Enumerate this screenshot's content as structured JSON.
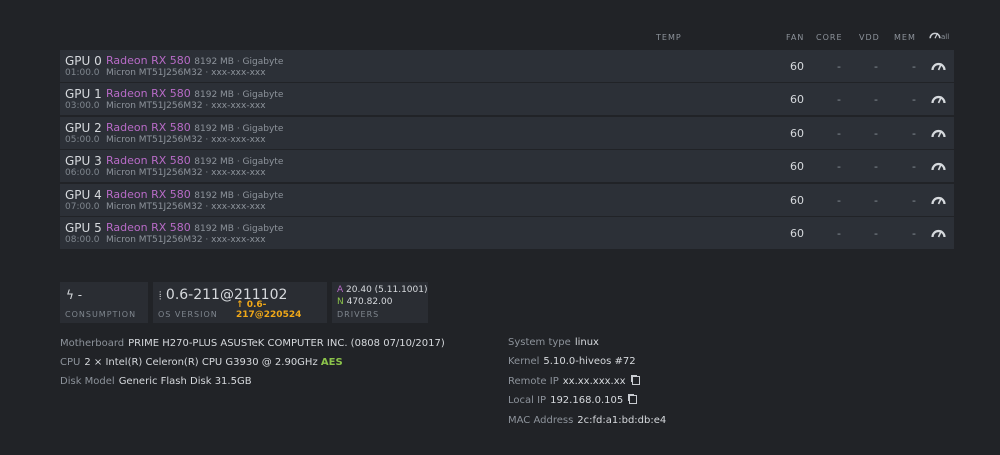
{
  "columns": {
    "temp": "TEMP",
    "fan": "FAN",
    "core": "CORE",
    "vdd": "VDD",
    "mem": "MEM",
    "all": "all"
  },
  "gpus": [
    {
      "name": "GPU 0",
      "bus": "01:00.0",
      "model": "Radeon RX 580",
      "memory": "8192 MB · Gigabyte",
      "sub": "Micron MT51J256M32 · xxx-xxx-xxx",
      "fan": "60",
      "core": "-",
      "vdd": "-",
      "mem": "-"
    },
    {
      "name": "GPU 1",
      "bus": "03:00.0",
      "model": "Radeon RX 580",
      "memory": "8192 MB · Gigabyte",
      "sub": "Micron MT51J256M32 · xxx-xxx-xxx",
      "fan": "60",
      "core": "-",
      "vdd": "-",
      "mem": "-"
    },
    {
      "name": "GPU 2",
      "bus": "05:00.0",
      "model": "Radeon RX 580",
      "memory": "8192 MB · Gigabyte",
      "sub": "Micron MT51J256M32 · xxx-xxx-xxx",
      "fan": "60",
      "core": "-",
      "vdd": "-",
      "mem": "-"
    },
    {
      "name": "GPU 3",
      "bus": "06:00.0",
      "model": "Radeon RX 580",
      "memory": "8192 MB · Gigabyte",
      "sub": "Micron MT51J256M32 · xxx-xxx-xxx",
      "fan": "60",
      "core": "-",
      "vdd": "-",
      "mem": "-"
    },
    {
      "name": "GPU 4",
      "bus": "07:00.0",
      "model": "Radeon RX 580",
      "memory": "8192 MB · Gigabyte",
      "sub": "Micron MT51J256M32 · xxx-xxx-xxx",
      "fan": "60",
      "core": "-",
      "vdd": "-",
      "mem": "-"
    },
    {
      "name": "GPU 5",
      "bus": "08:00.0",
      "model": "Radeon RX 580",
      "memory": "8192 MB · Gigabyte",
      "sub": "Micron MT51J256M32 · xxx-xxx-xxx",
      "fan": "60",
      "core": "-",
      "vdd": "-",
      "mem": "-"
    }
  ],
  "consumption": {
    "value": "-",
    "label": "CONSUMPTION"
  },
  "os": {
    "version": "0.6-211@211102",
    "label": "OS VERSION",
    "update": "0.6-217@220524"
  },
  "drivers": {
    "a_prefix": "A",
    "a": "20.40 (5.11.1001)",
    "n_prefix": "N",
    "n": "470.82.00",
    "label": "DRIVERS"
  },
  "info": {
    "motherboard_k": "Motherboard",
    "motherboard": "PRIME H270-PLUS ASUSTeK COMPUTER INC. (0808 07/10/2017)",
    "cpu_k": "CPU",
    "cpu": "2 × Intel(R) Celeron(R) CPU G3930 @ 2.90GHz",
    "cpu_flag": "AES",
    "disk_k": "Disk Model",
    "disk": "Generic Flash Disk 31.5GB",
    "systype_k": "System type",
    "systype": "linux",
    "kernel_k": "Kernel",
    "kernel": "5.10.0-hiveos #72",
    "remote_k": "Remote IP",
    "remote": "xx.xx.xxx.xx",
    "local_k": "Local IP",
    "local": "192.168.0.105",
    "mac_k": "MAC Address",
    "mac": "2c:fd:a1:bd:db:e4"
  },
  "colors": {
    "accent": "#b86bc7",
    "update": "#f0a818",
    "aes": "#8bc34a"
  }
}
